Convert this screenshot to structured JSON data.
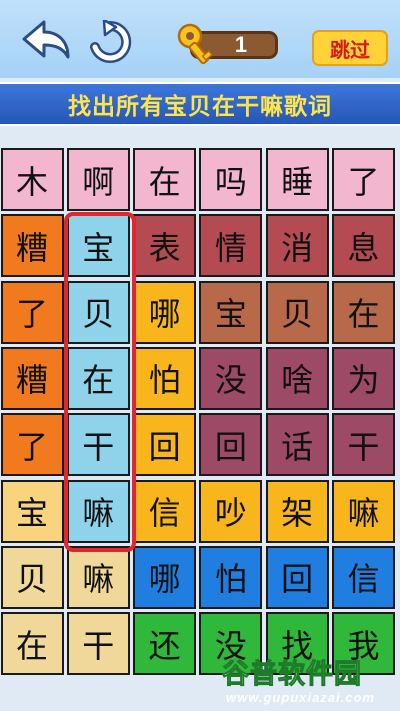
{
  "header": {
    "keys_count": "1",
    "skip_label": "跳过"
  },
  "instruction": "找出所有宝贝在干嘛歌词",
  "grid": {
    "rows": [
      [
        "木",
        "啊",
        "在",
        "吗",
        "睡",
        "了"
      ],
      [
        "糟",
        "宝",
        "表",
        "情",
        "消",
        "息"
      ],
      [
        "了",
        "贝",
        "哪",
        "宝",
        "贝",
        "在"
      ],
      [
        "糟",
        "在",
        "怕",
        "没",
        "啥",
        "为"
      ],
      [
        "了",
        "干",
        "回",
        "回",
        "话",
        "干"
      ],
      [
        "宝",
        "嘛",
        "信",
        "吵",
        "架",
        "嘛"
      ],
      [
        "贝",
        "嘛",
        "哪",
        "怕",
        "回",
        "信"
      ],
      [
        "在",
        "干",
        "还",
        "没",
        "找",
        "我"
      ]
    ],
    "colors": [
      [
        "#f2b7cf",
        "#f2b7cf",
        "#f2b7cf",
        "#f2b7cf",
        "#f2b7cf",
        "#f2b7cf"
      ],
      [
        "#f27a1e",
        "#8fd3ea",
        "#b44a52",
        "#b44a52",
        "#b44a52",
        "#b44a52"
      ],
      [
        "#f27a1e",
        "#8fd3ea",
        "#f8b51c",
        "#b8694a",
        "#b8694a",
        "#b8694a"
      ],
      [
        "#f27a1e",
        "#8fd3ea",
        "#f8b51c",
        "#9c4a66",
        "#9c4a66",
        "#9c4a66"
      ],
      [
        "#f27a1e",
        "#8fd3ea",
        "#f8b51c",
        "#9c4a66",
        "#9c4a66",
        "#9c4a66"
      ],
      [
        "#f8d47e",
        "#8fd3ea",
        "#f8b51c",
        "#f8b51c",
        "#f8b51c",
        "#f8b51c"
      ],
      [
        "#f0d89a",
        "#f0d89a",
        "#1f7ee0",
        "#1f7ee0",
        "#1f7ee0",
        "#1f7ee0"
      ],
      [
        "#f0d89a",
        "#f0d89a",
        "#2fb83a",
        "#2fb83a",
        "#2fb83a",
        "#2fb83a"
      ]
    ]
  },
  "watermark": {
    "title": "谷普软件园",
    "url": "www.gupuxiazai.com"
  }
}
